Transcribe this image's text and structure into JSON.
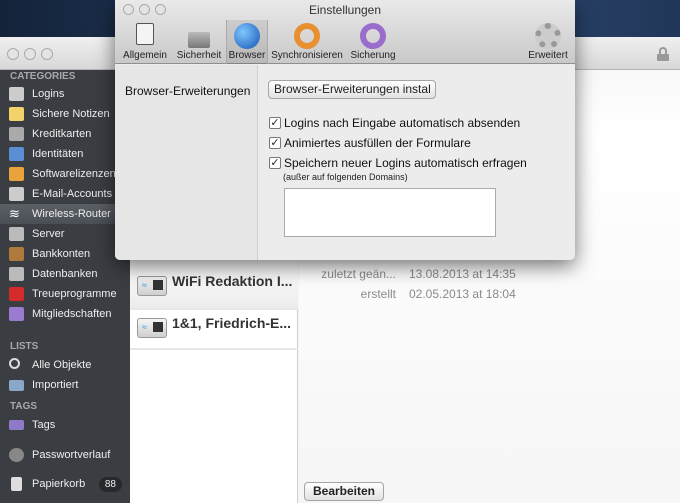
{
  "main_window": {
    "sidebar": {
      "categories_heading": "CATEGORIES",
      "categories": [
        {
          "label": "Logins",
          "icon": "login-icon"
        },
        {
          "label": "Sichere Notizen",
          "icon": "note-icon"
        },
        {
          "label": "Kreditkarten",
          "icon": "credit-card-icon"
        },
        {
          "label": "Identitäten",
          "icon": "identity-icon"
        },
        {
          "label": "Softwarelizenzen",
          "icon": "software-license-icon"
        },
        {
          "label": "E-Mail-Accounts",
          "icon": "mail-icon"
        },
        {
          "label": "Wireless-Router",
          "icon": "wifi-icon",
          "selected": true
        },
        {
          "label": "Server",
          "icon": "server-icon"
        },
        {
          "label": "Bankkonten",
          "icon": "bank-icon"
        },
        {
          "label": "Datenbanken",
          "icon": "database-icon"
        },
        {
          "label": "Treueprogramme",
          "icon": "bow-icon"
        },
        {
          "label": "Mitgliedschaften",
          "icon": "membership-icon"
        }
      ],
      "lists_heading": "LISTS",
      "lists": [
        {
          "label": "Alle Objekte",
          "icon": "search-icon"
        },
        {
          "label": "Importiert",
          "icon": "folder-icon"
        }
      ],
      "tags_heading": "TAGS",
      "tags": [
        {
          "label": "Tags",
          "icon": "tag-icon"
        }
      ],
      "password_history": "Passwortverlauf",
      "trash": {
        "label": "Papierkorb",
        "count": "88"
      }
    },
    "list": [
      {
        "title": "WiFi Redaktion I..."
      },
      {
        "title": "1&1, Friedrich-E..."
      }
    ],
    "detail": {
      "modified_label": "zuletzt geän...",
      "modified_value": "13.08.2013 at 14:35",
      "created_label": "erstellt",
      "created_value": "02.05.2013 at 18:04",
      "edit_button": "Bearbeiten"
    }
  },
  "prefs": {
    "title": "Einstellungen",
    "toolbar": [
      {
        "label": "Allgemein",
        "icon": "switch-icon"
      },
      {
        "label": "Sicherheit",
        "icon": "lock-icon"
      },
      {
        "label": "Browser",
        "icon": "globe-icon",
        "selected": true
      },
      {
        "label": "Synchronisieren",
        "icon": "sync-icon"
      },
      {
        "label": "Sicherung",
        "icon": "backup-icon"
      },
      {
        "label": "Erweitert",
        "icon": "gear-icon"
      }
    ],
    "section_label": "Browser-Erweiterungen",
    "install_button": "Browser-Erweiterungen instal",
    "options": [
      {
        "label": "Logins nach Eingabe automatisch absenden",
        "checked": true
      },
      {
        "label": "Animiertes ausfüllen der Formulare",
        "checked": true
      },
      {
        "label": "Speichern neuer Logins automatisch erfragen",
        "checked": true
      }
    ],
    "exclusion_note": "(außer auf folgenden Domains)",
    "domains_value": ""
  }
}
